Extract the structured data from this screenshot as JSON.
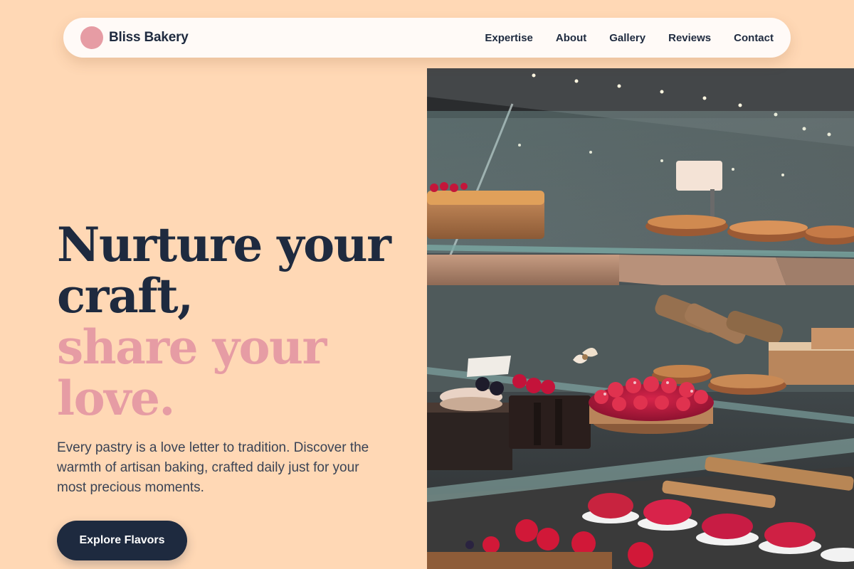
{
  "brand": {
    "name": "Bliss Bakery",
    "logo_color": "#e69ca4"
  },
  "nav": {
    "links": [
      "Expertise",
      "About",
      "Gallery",
      "Reviews",
      "Contact"
    ]
  },
  "hero": {
    "title_lines": [
      "Nurture your",
      "craft,",
      "share your",
      "love."
    ],
    "description": "Every pastry is a love letter to tradition. Discover the warmth of artisan baking, crafted daily just for your most precious moments.",
    "cta_label": "Explore Flavors",
    "image_subject": "glass-display-case-with-pastries-and-berry-tarts"
  },
  "colors": {
    "background": "#ffd8b5",
    "navy": "#1e2a3f",
    "pink": "#e69ca4",
    "nav_background": "#fffaf7"
  }
}
